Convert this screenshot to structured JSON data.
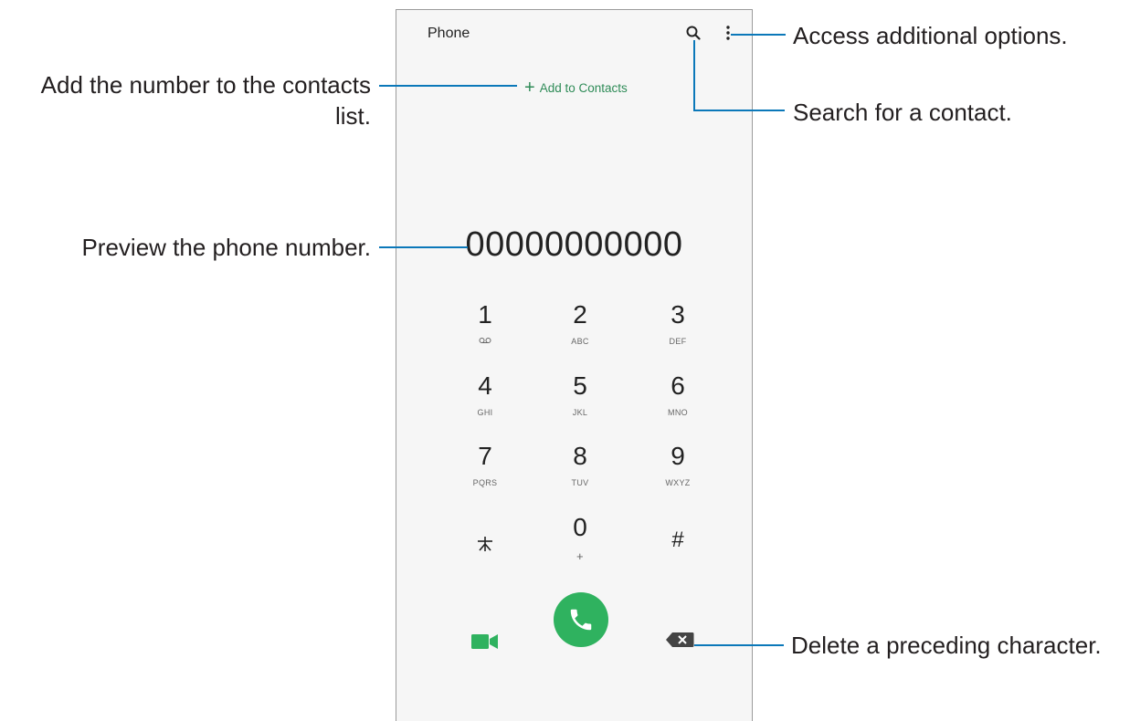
{
  "app": {
    "title": "Phone",
    "add_to_contacts": "Add to Contacts",
    "dialed_number": "00000000000"
  },
  "keypad": [
    {
      "digit": "1",
      "letters": ""
    },
    {
      "digit": "2",
      "letters": "ABC"
    },
    {
      "digit": "3",
      "letters": "DEF"
    },
    {
      "digit": "4",
      "letters": "GHI"
    },
    {
      "digit": "5",
      "letters": "JKL"
    },
    {
      "digit": "6",
      "letters": "MNO"
    },
    {
      "digit": "7",
      "letters": "PQRS"
    },
    {
      "digit": "8",
      "letters": "TUV"
    },
    {
      "digit": "9",
      "letters": "WXYZ"
    },
    {
      "digit": "*",
      "letters": ""
    },
    {
      "digit": "0",
      "letters": "+"
    },
    {
      "digit": "#",
      "letters": ""
    }
  ],
  "callouts": {
    "options": "Access additional options.",
    "search": "Search for a contact.",
    "add_line1": "Add the number to the contacts",
    "add_line2": "list.",
    "preview": "Preview the phone number.",
    "delete": "Delete a preceding character."
  },
  "colors": {
    "accent_green": "#2fb25f",
    "callout_line": "#0b78b9"
  },
  "icons": [
    "search-icon",
    "more-options-icon",
    "voicemail-icon",
    "video-call-icon",
    "phone-icon",
    "backspace-icon"
  ]
}
